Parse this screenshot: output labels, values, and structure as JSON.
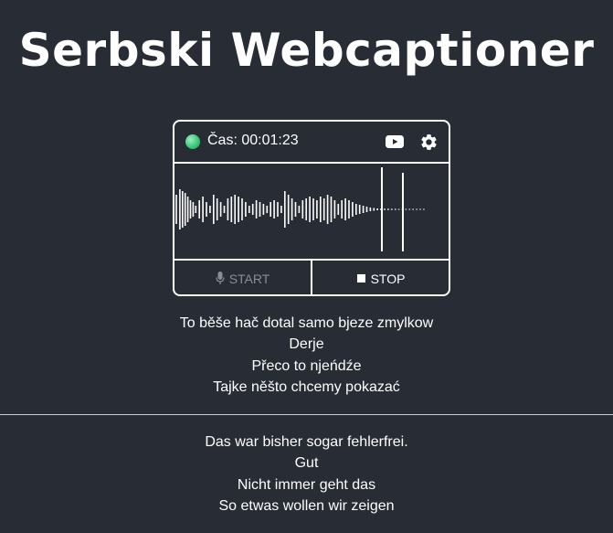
{
  "app": {
    "title": "Serbski Webcaptioner"
  },
  "panel": {
    "status": {
      "color": "#3dc77a",
      "time_label": "Čas: 00:01:23"
    },
    "icons": {
      "youtube": "youtube-icon",
      "settings": "gear-icon"
    },
    "controls": {
      "start_label": "START",
      "stop_label": "STOP"
    }
  },
  "captions": {
    "sorbian": [
      "To běše hač dotal samo bjeze zmylkow",
      "Derje",
      "Přeco to njeńdźe",
      "Tajke něšto chcemy pokazać"
    ],
    "german": [
      "Das war bisher sogar fehlerfrei.",
      "Gut",
      "Nicht immer geht das",
      "So etwas wollen wir zeigen"
    ]
  },
  "colors": {
    "background": "#282c34",
    "foreground": "#ffffff",
    "disabled": "#8a8d92"
  }
}
